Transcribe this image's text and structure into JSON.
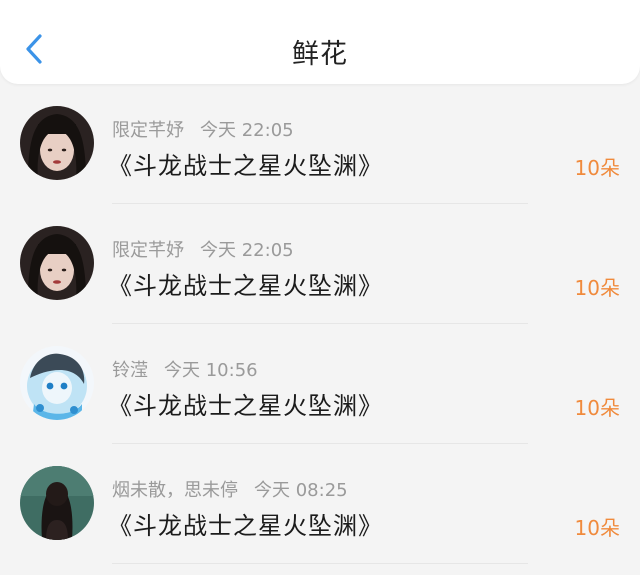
{
  "header": {
    "title": "鲜花",
    "back_icon": "chevron-left-icon",
    "accent": "#3b93e8"
  },
  "items": [
    {
      "name": "限定芊妤",
      "time": "今天 22:05",
      "book": "《斗龙战士之星火坠渊》",
      "amount": "10朵"
    },
    {
      "name": "限定芊妤",
      "time": "今天 22:05",
      "book": "《斗龙战士之星火坠渊》",
      "amount": "10朵"
    },
    {
      "name": "铃滢",
      "time": "今天 10:56",
      "book": "《斗龙战士之星火坠渊》",
      "amount": "10朵"
    },
    {
      "name": "烟未散，思未停",
      "time": "今天 08:25",
      "book": "《斗龙战士之星火坠渊》",
      "amount": "10朵"
    }
  ],
  "colors": {
    "amount": "#f08a3c",
    "meta": "#9a9a9a"
  }
}
